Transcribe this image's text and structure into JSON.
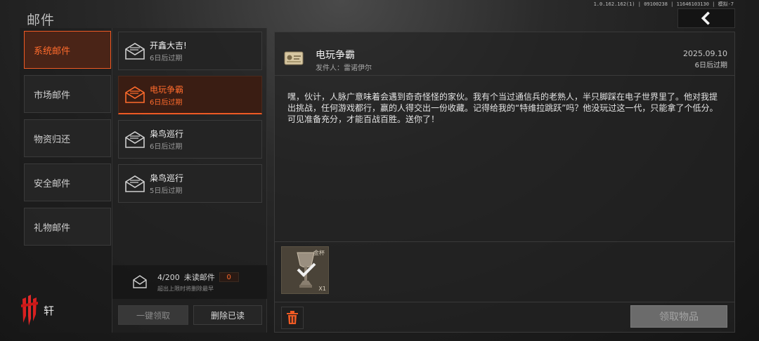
{
  "header": {
    "title": "邮件",
    "version": "1.0.162.162(1) | 09100238 | 11646103130 | 模拟-7",
    "back_icon": "chevron-left-icon"
  },
  "categories": [
    {
      "label": "系统邮件",
      "active": true
    },
    {
      "label": "市场邮件",
      "active": false
    },
    {
      "label": "物资归还",
      "active": false
    },
    {
      "label": "安全邮件",
      "active": false
    },
    {
      "label": "礼物邮件",
      "active": false
    }
  ],
  "brand": {
    "text": "轩",
    "logo_icon": "brand-logo-icon"
  },
  "mail_list": [
    {
      "title": "开鑫大吉!",
      "expire": "6日后过期",
      "active": false
    },
    {
      "title": "电玩争霸",
      "expire": "6日后过期",
      "active": true
    },
    {
      "title": "枭鸟巡行",
      "expire": "6日后过期",
      "active": false
    },
    {
      "title": "枭鸟巡行",
      "expire": "5日后过期",
      "active": false
    }
  ],
  "list_footer": {
    "count": "4/200",
    "unread_label": "未读邮件",
    "unread_count": "0",
    "note": "超出上限时将删除最早"
  },
  "buttons": {
    "collect_all": "一键领取",
    "delete_read": "删除已读",
    "collect_items": "领取物品"
  },
  "detail": {
    "title": "电玩争霸",
    "sender": "发件人：雷诺伊尔",
    "date": "2025.09.10",
    "expire": "6日后过期",
    "body": "嘿，伙计，人脉广意味着会遇到奇奇怪怪的家伙。我有个当过通信兵的老熟人，半只脚踩在电子世界里了。他对我提出挑战，任何游戏都行，赢的人得交出一份收藏。记得给我的“特维拉跳跃”吗？他没玩过这一代，只能拿了个低分。可见准备充分，才能百战百胜。送你了！",
    "attachments": [
      {
        "name": "金杯",
        "qty": "X1",
        "icon": "golden-cup-icon",
        "claimed": true
      }
    ]
  },
  "colors": {
    "accent": "#ee5a24",
    "active_text": "#ff6b2c",
    "panel": "#242424"
  }
}
